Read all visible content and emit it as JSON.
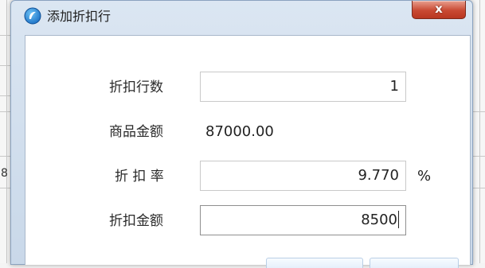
{
  "dialog": {
    "title": "添加折扣行",
    "close_label": "x"
  },
  "background": {
    "cell_fragment": "8"
  },
  "form": {
    "discount_rows_label": "折扣行数",
    "discount_rows_value": "1",
    "goods_amount_label": "商品金额",
    "goods_amount_value": "87000.00",
    "discount_rate_label": "折 扣 率",
    "discount_rate_value": "9.770",
    "discount_rate_unit": "%",
    "discount_amount_label": "折扣金额",
    "discount_amount_value": "8500"
  },
  "icons": {
    "app": "app-logo-icon",
    "close": "close-icon"
  },
  "colors": {
    "titlebar": "#dbe6f2",
    "close_button": "#c94a33",
    "content_bg": "#ffffff"
  }
}
